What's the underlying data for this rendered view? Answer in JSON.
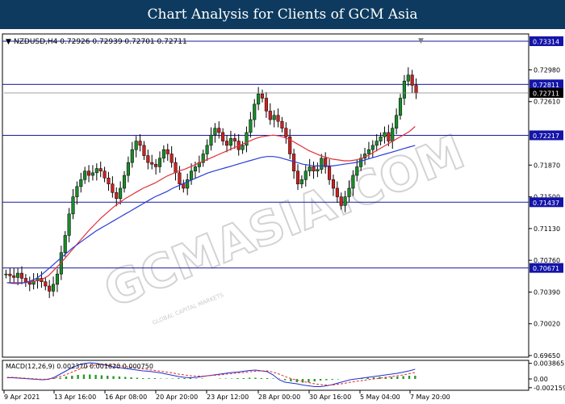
{
  "header": {
    "title": "Chart Analysis for Clients of GCM Asia"
  },
  "main_chart": {
    "info_text": "NZDUSD,H4  0.72926 0.72939 0.72701 0.72711",
    "price_ticks": [
      "0.72980",
      "0.72610",
      "0.71870",
      "0.71500",
      "0.71130",
      "0.70760",
      "0.70390",
      "0.70020",
      "0.69650"
    ],
    "levels": [
      {
        "label": "0.73314",
        "price": 0.73314
      },
      {
        "label": "0.72811",
        "price": 0.72811
      },
      {
        "label": "0.72217",
        "price": 0.72217
      },
      {
        "label": "0.71437",
        "price": 0.71437
      },
      {
        "label": "0.70671",
        "price": 0.70671
      }
    ],
    "current_price_label": "0.72711",
    "current_price": 0.72711,
    "watermark_text": "GCMASIA.COM",
    "watermark_subtext": "GLOBAL CAPITAL MARKETS"
  },
  "macd": {
    "info_text": "MACD(12,26,9)  0.002370  0.001620  0.000750",
    "ticks": [
      "0.003865",
      "0.00",
      "-0.002159"
    ]
  },
  "x_axis": {
    "labels": [
      "9 Apr 2021",
      "13 Apr 16:00",
      "16 Apr 08:00",
      "20 Apr 20:00",
      "23 Apr 12:00",
      "28 Apr 00:00",
      "30 Apr 16:00",
      "5 May 04:00",
      "7 May 20:00"
    ]
  },
  "colors": {
    "header_bg": "#0d3a5e",
    "level_line": "#1a1aa0",
    "ma_fast": "#e0303a",
    "ma_slow": "#2a3ed6",
    "macd_hist": "#2a9a2a",
    "macd_line": "#2030d0",
    "macd_signal": "#e03030",
    "candle_up": "#1a8a2a",
    "candle_down": "#cc2020"
  },
  "chart_data": {
    "type": "candlestick",
    "symbol": "NZDUSD",
    "timeframe": "H4",
    "ylim": [
      0.6965,
      0.7338
    ],
    "close": [
      0.706,
      0.7058,
      0.7056,
      0.7061,
      0.7055,
      0.705,
      0.7048,
      0.7052,
      0.7055,
      0.7051,
      0.7046,
      0.704,
      0.7048,
      0.706,
      0.7085,
      0.7105,
      0.713,
      0.715,
      0.7162,
      0.717,
      0.718,
      0.7175,
      0.7178,
      0.7183,
      0.718,
      0.7172,
      0.7165,
      0.7155,
      0.7148,
      0.716,
      0.7175,
      0.719,
      0.7205,
      0.7215,
      0.721,
      0.7198,
      0.719,
      0.7188,
      0.7185,
      0.7195,
      0.7205,
      0.72,
      0.719,
      0.7178,
      0.7165,
      0.716,
      0.717,
      0.718,
      0.7185,
      0.719,
      0.72,
      0.721,
      0.7222,
      0.723,
      0.7225,
      0.7215,
      0.721,
      0.7218,
      0.7215,
      0.7205,
      0.721,
      0.7225,
      0.724,
      0.7258,
      0.727,
      0.7265,
      0.725,
      0.724,
      0.7245,
      0.7238,
      0.723,
      0.722,
      0.72,
      0.718,
      0.7165,
      0.717,
      0.718,
      0.7185,
      0.718,
      0.7182,
      0.7195,
      0.7185,
      0.717,
      0.716,
      0.715,
      0.714,
      0.715,
      0.716,
      0.7175,
      0.7185,
      0.7195,
      0.72,
      0.7205,
      0.721,
      0.7215,
      0.722,
      0.7225,
      0.7215,
      0.723,
      0.7245,
      0.7265,
      0.7285,
      0.7292,
      0.728,
      0.7271
    ],
    "moving_averages": [
      {
        "color": "#e0303a",
        "values": [
          0.705,
          0.705,
          0.705,
          0.705,
          0.7051,
          0.7052,
          0.7054,
          0.7058,
          0.7065,
          0.7072,
          0.708,
          0.7088,
          0.7096,
          0.7104,
          0.7112,
          0.7119,
          0.7126,
          0.7132,
          0.7138,
          0.7143,
          0.7148,
          0.7152,
          0.7156,
          0.716,
          0.7163,
          0.7166,
          0.717,
          0.7174,
          0.7177,
          0.718,
          0.7182,
          0.7185,
          0.7188,
          0.7191,
          0.7194,
          0.7197,
          0.72,
          0.7203,
          0.7206,
          0.7209,
          0.7212,
          0.7215,
          0.7218,
          0.722,
          0.7221,
          0.7222,
          0.7221,
          0.7219,
          0.7216,
          0.7212,
          0.7208,
          0.7204,
          0.7201,
          0.7198,
          0.7196,
          0.7194,
          0.7193,
          0.7192,
          0.7192,
          0.7193,
          0.7195,
          0.7198,
          0.7202,
          0.7206,
          0.721,
          0.7214,
          0.7218,
          0.7222,
          0.7226,
          0.7232
        ]
      },
      {
        "color": "#2a3ed6",
        "values": [
          0.705,
          0.7049,
          0.7049,
          0.705,
          0.7052,
          0.7055,
          0.706,
          0.7066,
          0.7072,
          0.7078,
          0.7084,
          0.709,
          0.7095,
          0.71,
          0.7105,
          0.711,
          0.7114,
          0.7118,
          0.7122,
          0.7126,
          0.713,
          0.7134,
          0.7138,
          0.7142,
          0.7146,
          0.715,
          0.7153,
          0.7156,
          0.716,
          0.7163,
          0.7166,
          0.7169,
          0.7172,
          0.7175,
          0.7178,
          0.718,
          0.7182,
          0.7184,
          0.7186,
          0.7188,
          0.719,
          0.7192,
          0.7194,
          0.7196,
          0.7197,
          0.7197,
          0.7196,
          0.7194,
          0.7192,
          0.719,
          0.7188,
          0.7187,
          0.7186,
          0.7186,
          0.7186,
          0.7186,
          0.7187,
          0.7188,
          0.7189,
          0.719,
          0.7192,
          0.7194,
          0.7196,
          0.7198,
          0.72,
          0.7202,
          0.7204,
          0.7206,
          0.7208,
          0.721
        ]
      }
    ],
    "macd": {
      "ylim": [
        -0.0026,
        0.0042
      ],
      "histogram": [
        0.0,
        0.0,
        0.0,
        0.0,
        0.0,
        0.0,
        0.0,
        0.0001,
        0.0002,
        0.0003,
        0.0006,
        0.0008,
        0.001,
        0.0011,
        0.0011,
        0.001,
        0.0009,
        0.0008,
        0.0007,
        0.0006,
        0.0005,
        0.0004,
        0.0003,
        0.0002,
        0.0002,
        0.0002,
        0.0001,
        0.0001,
        0.0001,
        0.0002,
        0.0002,
        0.0002,
        0.0001,
        0.0001,
        0.0,
        0.0,
        0.0001,
        0.0001,
        0.0001,
        0.0002,
        0.0002,
        0.0003,
        0.0003,
        0.0002,
        0.0002,
        0.0001,
        0.0001,
        -0.0003,
        -0.0006,
        -0.0008,
        -0.0009,
        -0.0008,
        -0.0006,
        -0.0004,
        -0.0003,
        -0.0002,
        -0.0001,
        0.0,
        0.0,
        0.0001,
        0.0002,
        0.0003,
        0.0004,
        0.0005,
        0.0005,
        0.0005,
        0.0006,
        0.0007,
        0.0008,
        0.0008
      ],
      "macd_line": [
        0.0003,
        0.0003,
        0.0002,
        0.0001,
        0.0,
        -0.0001,
        -0.0002,
        -0.0001,
        0.0004,
        0.0012,
        0.002,
        0.0028,
        0.0034,
        0.0038,
        0.004,
        0.0039,
        0.0036,
        0.0033,
        0.003,
        0.0028,
        0.0026,
        0.0024,
        0.0022,
        0.002,
        0.0019,
        0.0017,
        0.0015,
        0.0012,
        0.0009,
        0.0006,
        0.0004,
        0.0003,
        0.0004,
        0.0006,
        0.0008,
        0.001,
        0.0012,
        0.0014,
        0.0016,
        0.0017,
        0.0019,
        0.0021,
        0.0022,
        0.002,
        0.0018,
        0.001,
        -0.0002,
        -0.0008,
        -0.001,
        -0.0012,
        -0.0015,
        -0.0017,
        -0.0019,
        -0.0019,
        -0.0017,
        -0.0014,
        -0.001,
        -0.0006,
        -0.0002,
        0.0,
        0.0002,
        0.0004,
        0.0006,
        0.0008,
        0.001,
        0.0012,
        0.0014,
        0.0017,
        0.002,
        0.0024
      ],
      "signal_line": [
        0.0004,
        0.0004,
        0.0003,
        0.0002,
        0.0001,
        0.0,
        -0.0001,
        0.0,
        0.0002,
        0.0006,
        0.0011,
        0.0017,
        0.0023,
        0.0028,
        0.0032,
        0.0035,
        0.0036,
        0.0036,
        0.0035,
        0.0033,
        0.0031,
        0.0029,
        0.0027,
        0.0025,
        0.0023,
        0.0021,
        0.0019,
        0.0017,
        0.0015,
        0.0012,
        0.001,
        0.0008,
        0.0007,
        0.0007,
        0.0008,
        0.0009,
        0.001,
        0.0012,
        0.0013,
        0.0015,
        0.0016,
        0.0018,
        0.0019,
        0.002,
        0.002,
        0.0017,
        0.0012,
        0.0006,
        0.0001,
        -0.0003,
        -0.0006,
        -0.0009,
        -0.0012,
        -0.0014,
        -0.0015,
        -0.0015,
        -0.0013,
        -0.0011,
        -0.0008,
        -0.0006,
        -0.0004,
        -0.0002,
        0.0,
        0.0002,
        0.0004,
        0.0006,
        0.0008,
        0.001,
        0.0013,
        0.0016
      ]
    }
  }
}
